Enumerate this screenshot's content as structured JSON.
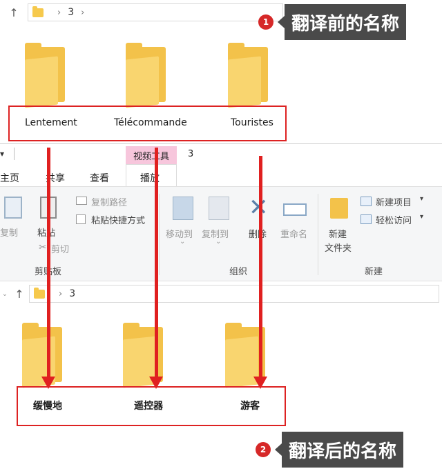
{
  "top_address": {
    "path_segment": "3"
  },
  "top_folders": [
    {
      "name": "Lentement"
    },
    {
      "name": "Télécommande"
    },
    {
      "name": "Touristes"
    }
  ],
  "annotation_1": {
    "number": "1",
    "text": "翻译前的名称"
  },
  "ribbon": {
    "context_group": "视频工具",
    "window_title": "3",
    "tabs": [
      "主页",
      "共享",
      "查看",
      "播放"
    ],
    "clipboard": {
      "copy": "复制",
      "paste": "粘贴",
      "copy_path": "复制路径",
      "paste_shortcut": "粘贴快捷方式",
      "cut": "剪切",
      "group_label": "剪贴板"
    },
    "organize": {
      "move_to": "移动到",
      "copy_to": "复制到",
      "delete": "删除",
      "rename": "重命名",
      "group_label": "组织"
    },
    "new": {
      "new_folder_line1": "新建",
      "new_folder_line2": "文件夹",
      "new_item": "新建项目",
      "easy_access": "轻松访问",
      "group_label": "新建"
    }
  },
  "bottom_address": {
    "path_segment": "3"
  },
  "bottom_folders": [
    {
      "name": "缓慢地"
    },
    {
      "name": "遥控器"
    },
    {
      "name": "游客"
    }
  ],
  "annotation_2": {
    "number": "2",
    "text": "翻译后的名称"
  },
  "colors": {
    "highlight_red": "#d22222",
    "folder_yellow": "#f3c24a",
    "context_tab_pink": "#f7c6dc",
    "badge_bg": "#4a4a4a"
  }
}
